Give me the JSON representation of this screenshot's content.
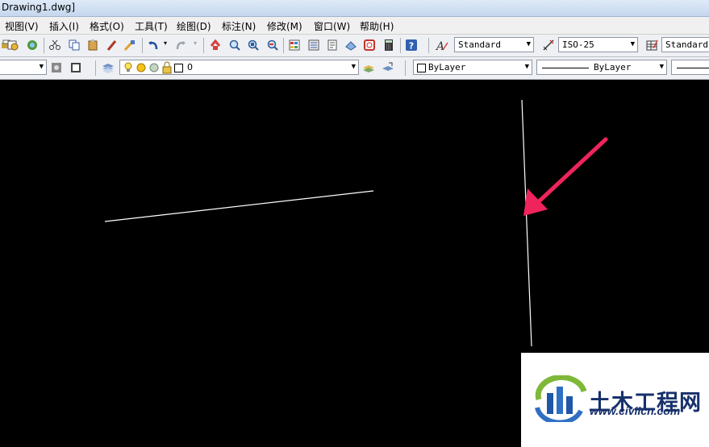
{
  "window": {
    "title": "Drawing1.dwg]"
  },
  "menu": [
    "视图(V)",
    "插入(I)",
    "格式(O)",
    "工具(T)",
    "绘图(D)",
    "标注(N)",
    "修改(M)",
    "窗口(W)",
    "帮助(H)"
  ],
  "toolbar": {
    "text_style": "Standard",
    "dim_style": "ISO-25",
    "table_style": "Standard",
    "layer_value": "0",
    "color_value": "ByLayer",
    "linetype_value": "ByLayer"
  },
  "watermark": {
    "name": "土木工程网",
    "url": "www.civilcn.com"
  },
  "colors": {
    "arrow": "#f0245c",
    "canvas": "#000000",
    "line": "#ffffff"
  }
}
